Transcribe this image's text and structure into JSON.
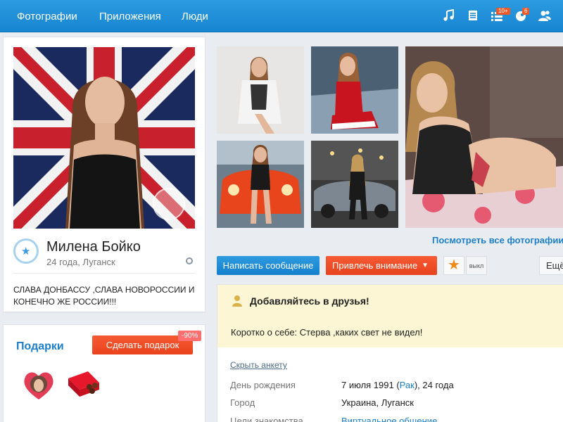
{
  "nav": {
    "items": [
      "Фотографии",
      "Приложения",
      "Люди"
    ],
    "icons": [
      "music-icon",
      "list-icon",
      "events-icon",
      "guests-icon",
      "friends-icon"
    ],
    "badges": {
      "events": "10+",
      "guests": "6"
    }
  },
  "profile": {
    "name": "Милена Бойко",
    "age_city": "24 года, Луганск",
    "status": "СЛАВА ДОНБАССУ ,СЛАВА НОВОРОССИИ И КОНЕЧНО ЖЕ РОССИИ!!!"
  },
  "gifts": {
    "title": "Подарки",
    "button_label": "Сделать подарок",
    "discount": "-90%"
  },
  "photos": {
    "see_all_label": "Посмотреть все фотографии"
  },
  "actions": {
    "write_message": "Написать сообщение",
    "attract_attention": "Привлечь внимание",
    "toggle_off": "выкл",
    "more": "Ещё"
  },
  "info": {
    "add_friend": "Добавляйтесь в друзья!",
    "about": "Коротко о себе: Стерва ,каких свет не видел!",
    "hide_link": "Скрыть анкету",
    "rows": [
      {
        "label": "День рождения",
        "value_pre": "7 июля 1991 (",
        "value_link": "Рак",
        "value_post": "), 24 года"
      },
      {
        "label": "Город",
        "value": "Украина, Луганск"
      },
      {
        "label": "Цели знакомства",
        "value_link": "Виртуальное общение"
      }
    ]
  },
  "colors": {
    "topbar": "#1786d1",
    "accent_blue": "#1d7fc9",
    "accent_orange": "#f05a28",
    "friend_box": "#fdf6d4"
  }
}
